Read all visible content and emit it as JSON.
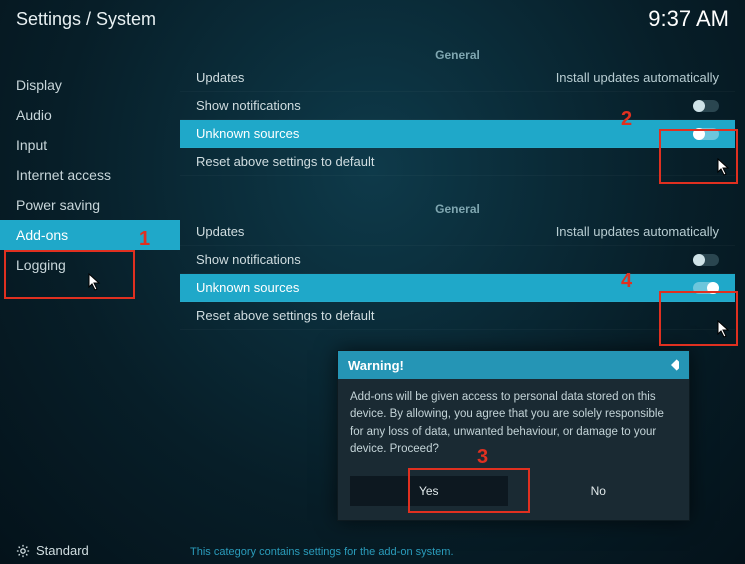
{
  "header": {
    "breadcrumb": "Settings / System",
    "time": "9:37 AM"
  },
  "sidebar": {
    "items": [
      {
        "label": "Display"
      },
      {
        "label": "Audio"
      },
      {
        "label": "Input"
      },
      {
        "label": "Internet access"
      },
      {
        "label": "Power saving"
      },
      {
        "label": "Add-ons"
      },
      {
        "label": "Logging"
      }
    ],
    "selected_index": 5
  },
  "panel1": {
    "section": "General",
    "rows": {
      "updates": {
        "label": "Updates",
        "value": "Install updates automatically"
      },
      "show_notifications": {
        "label": "Show notifications",
        "toggle": false
      },
      "unknown_sources": {
        "label": "Unknown sources",
        "toggle": false
      },
      "reset": {
        "label": "Reset above settings to default"
      }
    }
  },
  "panel2": {
    "section": "General",
    "rows": {
      "updates": {
        "label": "Updates",
        "value": "Install updates automatically"
      },
      "show_notifications": {
        "label": "Show notifications",
        "toggle": false
      },
      "unknown_sources": {
        "label": "Unknown sources",
        "toggle": true
      },
      "reset": {
        "label": "Reset above settings to default"
      }
    }
  },
  "dialog": {
    "title": "Warning!",
    "body": "Add-ons will be given access to personal data stored on this device. By allowing, you agree that you are solely responsible for any loss of data, unwanted behaviour, or damage to your device. Proceed?",
    "yes": "Yes",
    "no": "No"
  },
  "footer": {
    "level": "Standard",
    "hint": "This category contains settings for the add-on system."
  },
  "annotations": {
    "n1": "1",
    "n2": "2",
    "n3": "3",
    "n4": "4"
  }
}
